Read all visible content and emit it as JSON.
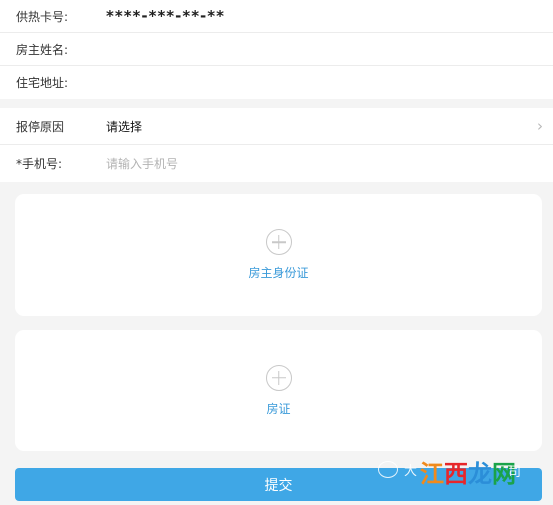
{
  "form": {
    "card_no": {
      "label": "供热卡号:",
      "value": "****-***-**-**"
    },
    "owner_name": {
      "label": "房主姓名:",
      "value": ""
    },
    "address": {
      "label": "住宅地址:",
      "value": ""
    },
    "reason": {
      "label": "报停原因",
      "value": "请选择",
      "chevron": "chevron-right-icon"
    },
    "phone": {
      "label": "*手机号:",
      "placeholder": "请输入手机号"
    }
  },
  "uploads": [
    {
      "label": "房主身份证",
      "icon": "plus-circle-icon"
    },
    {
      "label": "房证",
      "icon": "plus-circle-icon"
    }
  ],
  "submit_label": "提交",
  "watermark": {
    "prefix": "大",
    "logo_chars": [
      "江",
      "西",
      "龙",
      "网"
    ],
    "suffix": "司"
  },
  "colors": {
    "accent": "#3fa7e6",
    "link": "#3a9ad9",
    "background": "#f4f4f4"
  }
}
